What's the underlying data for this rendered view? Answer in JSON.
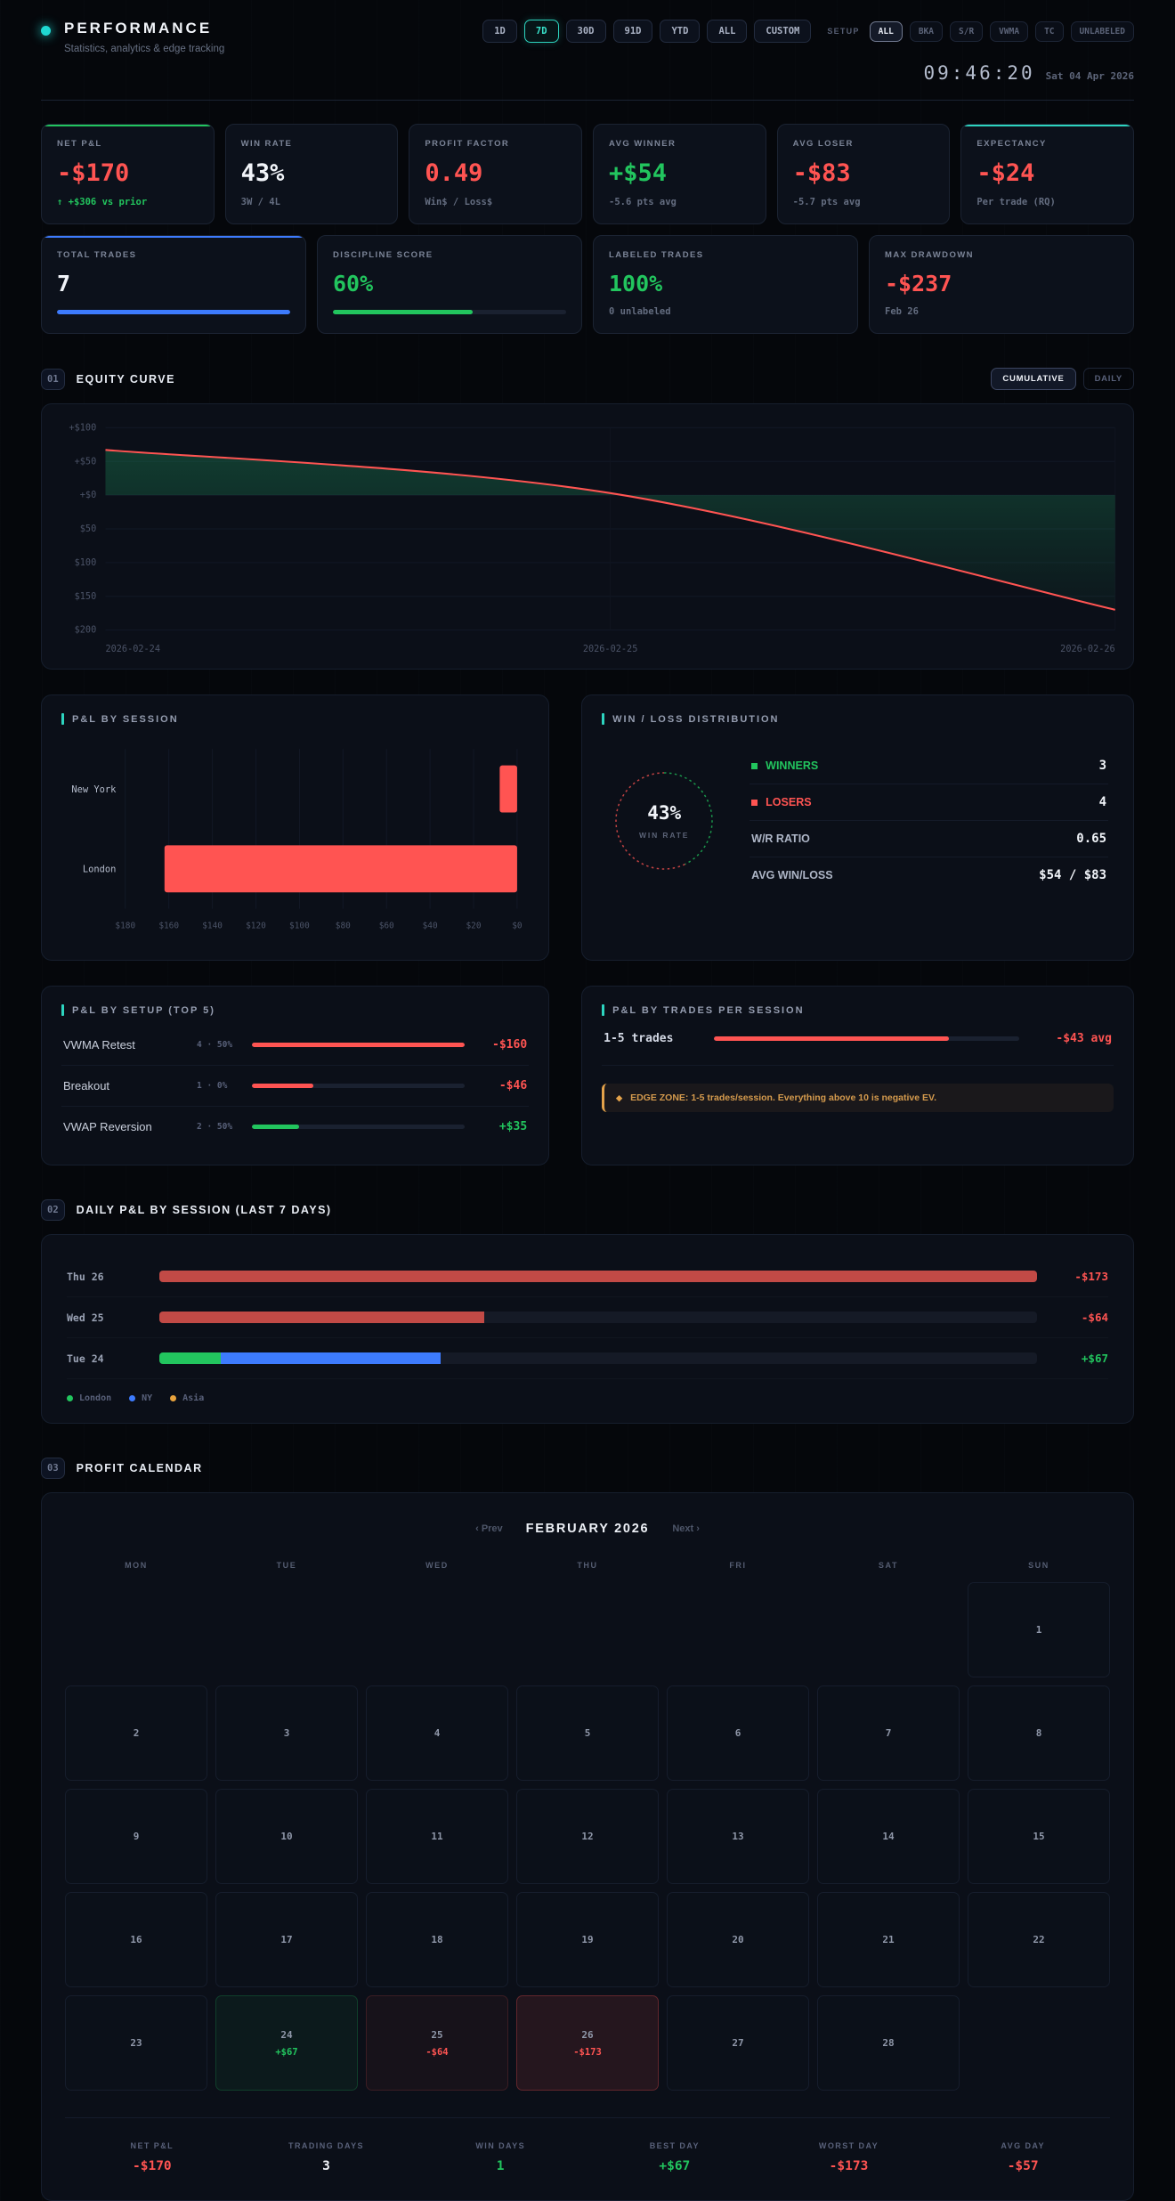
{
  "header": {
    "title": "PERFORMANCE",
    "subtitle": "Statistics, analytics & edge tracking",
    "accent_color": "#1fd8d2",
    "time_ranges": [
      {
        "label": "1D",
        "active": false
      },
      {
        "label": "7D",
        "active": true
      },
      {
        "label": "30D",
        "active": false
      },
      {
        "label": "91D",
        "active": false
      },
      {
        "label": "YTD",
        "active": false
      },
      {
        "label": "ALL",
        "active": false
      },
      {
        "label": "CUSTOM",
        "active": false
      }
    ],
    "setup_filter": {
      "label": "SETUP",
      "options": [
        {
          "label": "ALL",
          "active": true
        },
        {
          "label": "BKA",
          "active": false
        },
        {
          "label": "S/R",
          "active": false
        },
        {
          "label": "VWMA",
          "active": false
        },
        {
          "label": "TC",
          "active": false
        },
        {
          "label": "UNLABELED",
          "active": false
        }
      ]
    },
    "clock": "09:46:20",
    "date": "Sat 04 Apr 2026"
  },
  "kpi_row1": [
    {
      "label": "NET P&L",
      "value": "-$170",
      "value_tone": "red",
      "sub": "↑ +$306 vs prior",
      "sub_tone": "green",
      "accent": "#22c55e"
    },
    {
      "label": "WIN RATE",
      "value": "43%",
      "value_tone": "white",
      "sub": "3W / 4L",
      "sub_tone": "muted"
    },
    {
      "label": "PROFIT FACTOR",
      "value": "0.49",
      "value_tone": "red",
      "sub": "Win$ / Loss$",
      "sub_tone": "muted"
    },
    {
      "label": "AVG WINNER",
      "value": "+$54",
      "value_tone": "green",
      "sub": "-5.6 pts avg",
      "sub_tone": "muted"
    },
    {
      "label": "AVG LOSER",
      "value": "-$83",
      "value_tone": "red",
      "sub": "-5.7 pts avg",
      "sub_tone": "muted"
    },
    {
      "label": "EXPECTANCY",
      "value": "-$24",
      "value_tone": "red",
      "sub": "Per trade (RQ)",
      "sub_tone": "muted",
      "accent": "#2dd4bf"
    }
  ],
  "kpi_row2": [
    {
      "label": "TOTAL TRADES",
      "value": "7",
      "value_tone": "white",
      "accent": "#3d7bfd",
      "bar": {
        "pct": 100,
        "color": "#3d7bfd"
      }
    },
    {
      "label": "DISCIPLINE SCORE",
      "value": "60%",
      "value_tone": "green",
      "bar": {
        "pct": 60,
        "color": "#22c55e"
      }
    },
    {
      "label": "LABELED TRADES",
      "value": "100%",
      "value_tone": "green",
      "sub": "0 unlabeled",
      "sub_tone": "muted"
    },
    {
      "label": "MAX DRAWDOWN",
      "value": "-$237",
      "value_tone": "red",
      "sub": "Feb 26",
      "sub_tone": "muted"
    }
  ],
  "sections": [
    {
      "num": "01",
      "title": "EQUITY CURVE"
    },
    {
      "num": "02",
      "title": "DAILY P&L BY SESSION (LAST 7 DAYS)"
    },
    {
      "num": "03",
      "title": "PROFIT CALENDAR"
    }
  ],
  "equity_toggle": [
    {
      "label": "CUMULATIVE",
      "active": true
    },
    {
      "label": "DAILY",
      "active": false
    }
  ],
  "chart_data": [
    {
      "id": "equity_curve",
      "type": "area",
      "title": "EQUITY CURVE",
      "x": [
        "2026-02-24",
        "2026-02-25",
        "2026-02-26"
      ],
      "values": [
        67,
        3,
        -170
      ],
      "ylim": [
        -200,
        100
      ],
      "yticks": [
        {
          "v": 100,
          "label": "+$100"
        },
        {
          "v": 50,
          "label": "+$50"
        },
        {
          "v": 0,
          "label": "+$0"
        },
        {
          "v": -50,
          "label": "$50"
        },
        {
          "v": -100,
          "label": "$100"
        },
        {
          "v": -150,
          "label": "$150"
        },
        {
          "v": -200,
          "label": "$200"
        }
      ],
      "line_color": "#ff5452",
      "fill_color": "#1f9d63",
      "grid": true,
      "legend": "none"
    },
    {
      "id": "pnl_by_session",
      "type": "bar",
      "orientation": "horizontal",
      "title": "P&L BY SESSION",
      "categories": [
        "New York",
        "London"
      ],
      "values": [
        -8,
        -162
      ],
      "xlim": [
        -180,
        0
      ],
      "xticks": [
        "$180",
        "$160",
        "$140",
        "$120",
        "$100",
        "$80",
        "$60",
        "$40",
        "$20",
        "$0"
      ],
      "bar_color": "#ff5452",
      "grid": true
    },
    {
      "id": "win_loss_distribution",
      "type": "pie",
      "title": "WIN / LOSS DISTRIBUTION",
      "center_value": "43%",
      "center_label": "WIN RATE",
      "slices": [
        {
          "label": "WINNERS",
          "value": 3,
          "color": "#22c55e"
        },
        {
          "label": "LOSERS",
          "value": 4,
          "color": "#ff5452"
        }
      ],
      "stats": [
        {
          "label": "W/R RATIO",
          "value": "0.65"
        },
        {
          "label": "AVG WIN/LOSS",
          "value": "$54 / $83"
        }
      ]
    },
    {
      "id": "pnl_by_setup",
      "type": "bar",
      "title": "P&L BY SETUP (TOP 5)",
      "rows": [
        {
          "name": "VWMA Retest",
          "meta": "4 · 50%",
          "pct": 100,
          "pnl": -160,
          "value": "-$160"
        },
        {
          "name": "Breakout",
          "meta": "1 · 0%",
          "pct": 29,
          "pnl": -46,
          "value": "-$46"
        },
        {
          "name": "VWAP Reversion",
          "meta": "2 · 50%",
          "pct": 22,
          "pnl": 35,
          "value": "+$35"
        }
      ]
    },
    {
      "id": "pnl_by_trades_per_session",
      "type": "bar",
      "title": "P&L BY TRADES PER SESSION",
      "rows": [
        {
          "name": "1-5 trades",
          "pct": 77,
          "pnl": -43,
          "value": "-$43 avg"
        }
      ],
      "note_icon": "◆",
      "note": "EDGE ZONE: 1-5 trades/session. Everything above 10 is negative EV."
    },
    {
      "id": "daily_pnl_by_session",
      "type": "bar",
      "orientation": "horizontal",
      "title": "DAILY P&L BY SESSION (LAST 7 DAYS)",
      "rows": [
        {
          "label": "Thu 26",
          "pnl": -173,
          "value": "-$173",
          "tone": "red",
          "segments": [
            {
              "name": "loss",
              "color": "#c24a46",
              "pct": 100
            }
          ]
        },
        {
          "label": "Wed 25",
          "pnl": -64,
          "value": "-$64",
          "tone": "red",
          "segments": [
            {
              "name": "loss",
              "color": "#c24a46",
              "pct": 37
            }
          ]
        },
        {
          "label": "Tue 24",
          "pnl": 67,
          "value": "+$67",
          "tone": "green",
          "segments": [
            {
              "name": "London",
              "color": "#22c55e",
              "pct": 7
            },
            {
              "name": "NY",
              "color": "#3d7bfd",
              "pct": 25
            }
          ]
        }
      ],
      "legend": [
        {
          "label": "London",
          "color": "#22c55e"
        },
        {
          "label": "NY",
          "color": "#3d7bfd"
        },
        {
          "label": "Asia",
          "color": "#e8a33d"
        }
      ]
    },
    {
      "id": "profit_calendar",
      "type": "table",
      "title": "PROFIT CALENDAR",
      "month": "FEBRUARY 2026",
      "prev_label": "‹ Prev",
      "next_label": "Next ›",
      "weekdays": [
        "MON",
        "TUE",
        "WED",
        "THU",
        "FRI",
        "SAT",
        "SUN"
      ],
      "weeks": [
        [
          null,
          null,
          null,
          null,
          null,
          null,
          {
            "day": 1
          }
        ],
        [
          {
            "day": 2
          },
          {
            "day": 3
          },
          {
            "day": 4
          },
          {
            "day": 5
          },
          {
            "day": 6
          },
          {
            "day": 7
          },
          {
            "day": 8
          }
        ],
        [
          {
            "day": 9
          },
          {
            "day": 10
          },
          {
            "day": 11
          },
          {
            "day": 12
          },
          {
            "day": 13
          },
          {
            "day": 14
          },
          {
            "day": 15
          }
        ],
        [
          {
            "day": 16
          },
          {
            "day": 17
          },
          {
            "day": 18
          },
          {
            "day": 19
          },
          {
            "day": 20
          },
          {
            "day": 21
          },
          {
            "day": 22
          }
        ],
        [
          {
            "day": 23
          },
          {
            "day": 24,
            "pnl": "+$67",
            "tone": "win"
          },
          {
            "day": 25,
            "pnl": "-$64",
            "tone": "loss"
          },
          {
            "day": 26,
            "pnl": "-$173",
            "tone": "loss-strong"
          },
          {
            "day": 27
          },
          {
            "day": 28
          },
          null
        ]
      ],
      "summary": [
        {
          "label": "NET P&L",
          "value": "-$170",
          "tone": "red"
        },
        {
          "label": "TRADING DAYS",
          "value": "3",
          "tone": "white"
        },
        {
          "label": "WIN DAYS",
          "value": "1",
          "tone": "green"
        },
        {
          "label": "BEST DAY",
          "value": "+$67",
          "tone": "green"
        },
        {
          "label": "WORST DAY",
          "value": "-$173",
          "tone": "red"
        },
        {
          "label": "AVG DAY",
          "value": "-$57",
          "tone": "red"
        }
      ]
    }
  ]
}
